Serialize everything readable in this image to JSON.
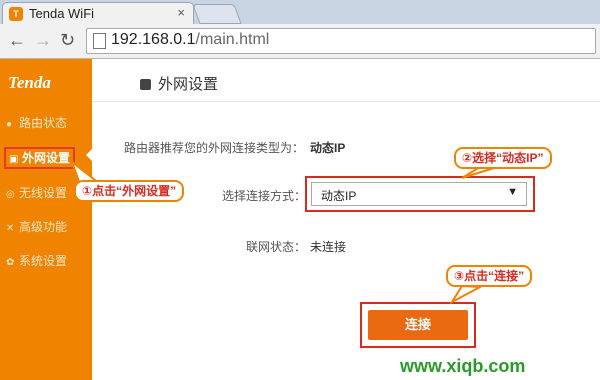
{
  "browser": {
    "tab_title": "Tenda WiFi",
    "tab_close": "×",
    "url_host": "192.168.0.1",
    "url_path": "/main.html"
  },
  "sidebar": {
    "logo": "Tenda",
    "items": [
      {
        "label": "路由状态",
        "icon": "●"
      },
      {
        "label": "外网设置",
        "icon": "▣"
      },
      {
        "label": "无线设置",
        "icon": "◎"
      },
      {
        "label": "高级功能",
        "icon": "✕"
      },
      {
        "label": "系统设置",
        "icon": "✿"
      }
    ]
  },
  "main": {
    "title": "外网设置",
    "recommend_label": "路由器推荐您的外网连接类型为：",
    "recommend_value": "动态IP",
    "connection_label": "选择连接方式：",
    "connection_value": "动态IP",
    "status_label": "联网状态：",
    "status_value": "未连接",
    "connect_button": "连接"
  },
  "annotations": {
    "step1": "①点击“外网设置”",
    "step2": "②选择“动态IP”",
    "step3": "③点击“连接”"
  },
  "watermark": "www.xiqb.com",
  "colors": {
    "accent": "#f08300",
    "highlight": "#d72b20",
    "button": "#ea6a12"
  }
}
